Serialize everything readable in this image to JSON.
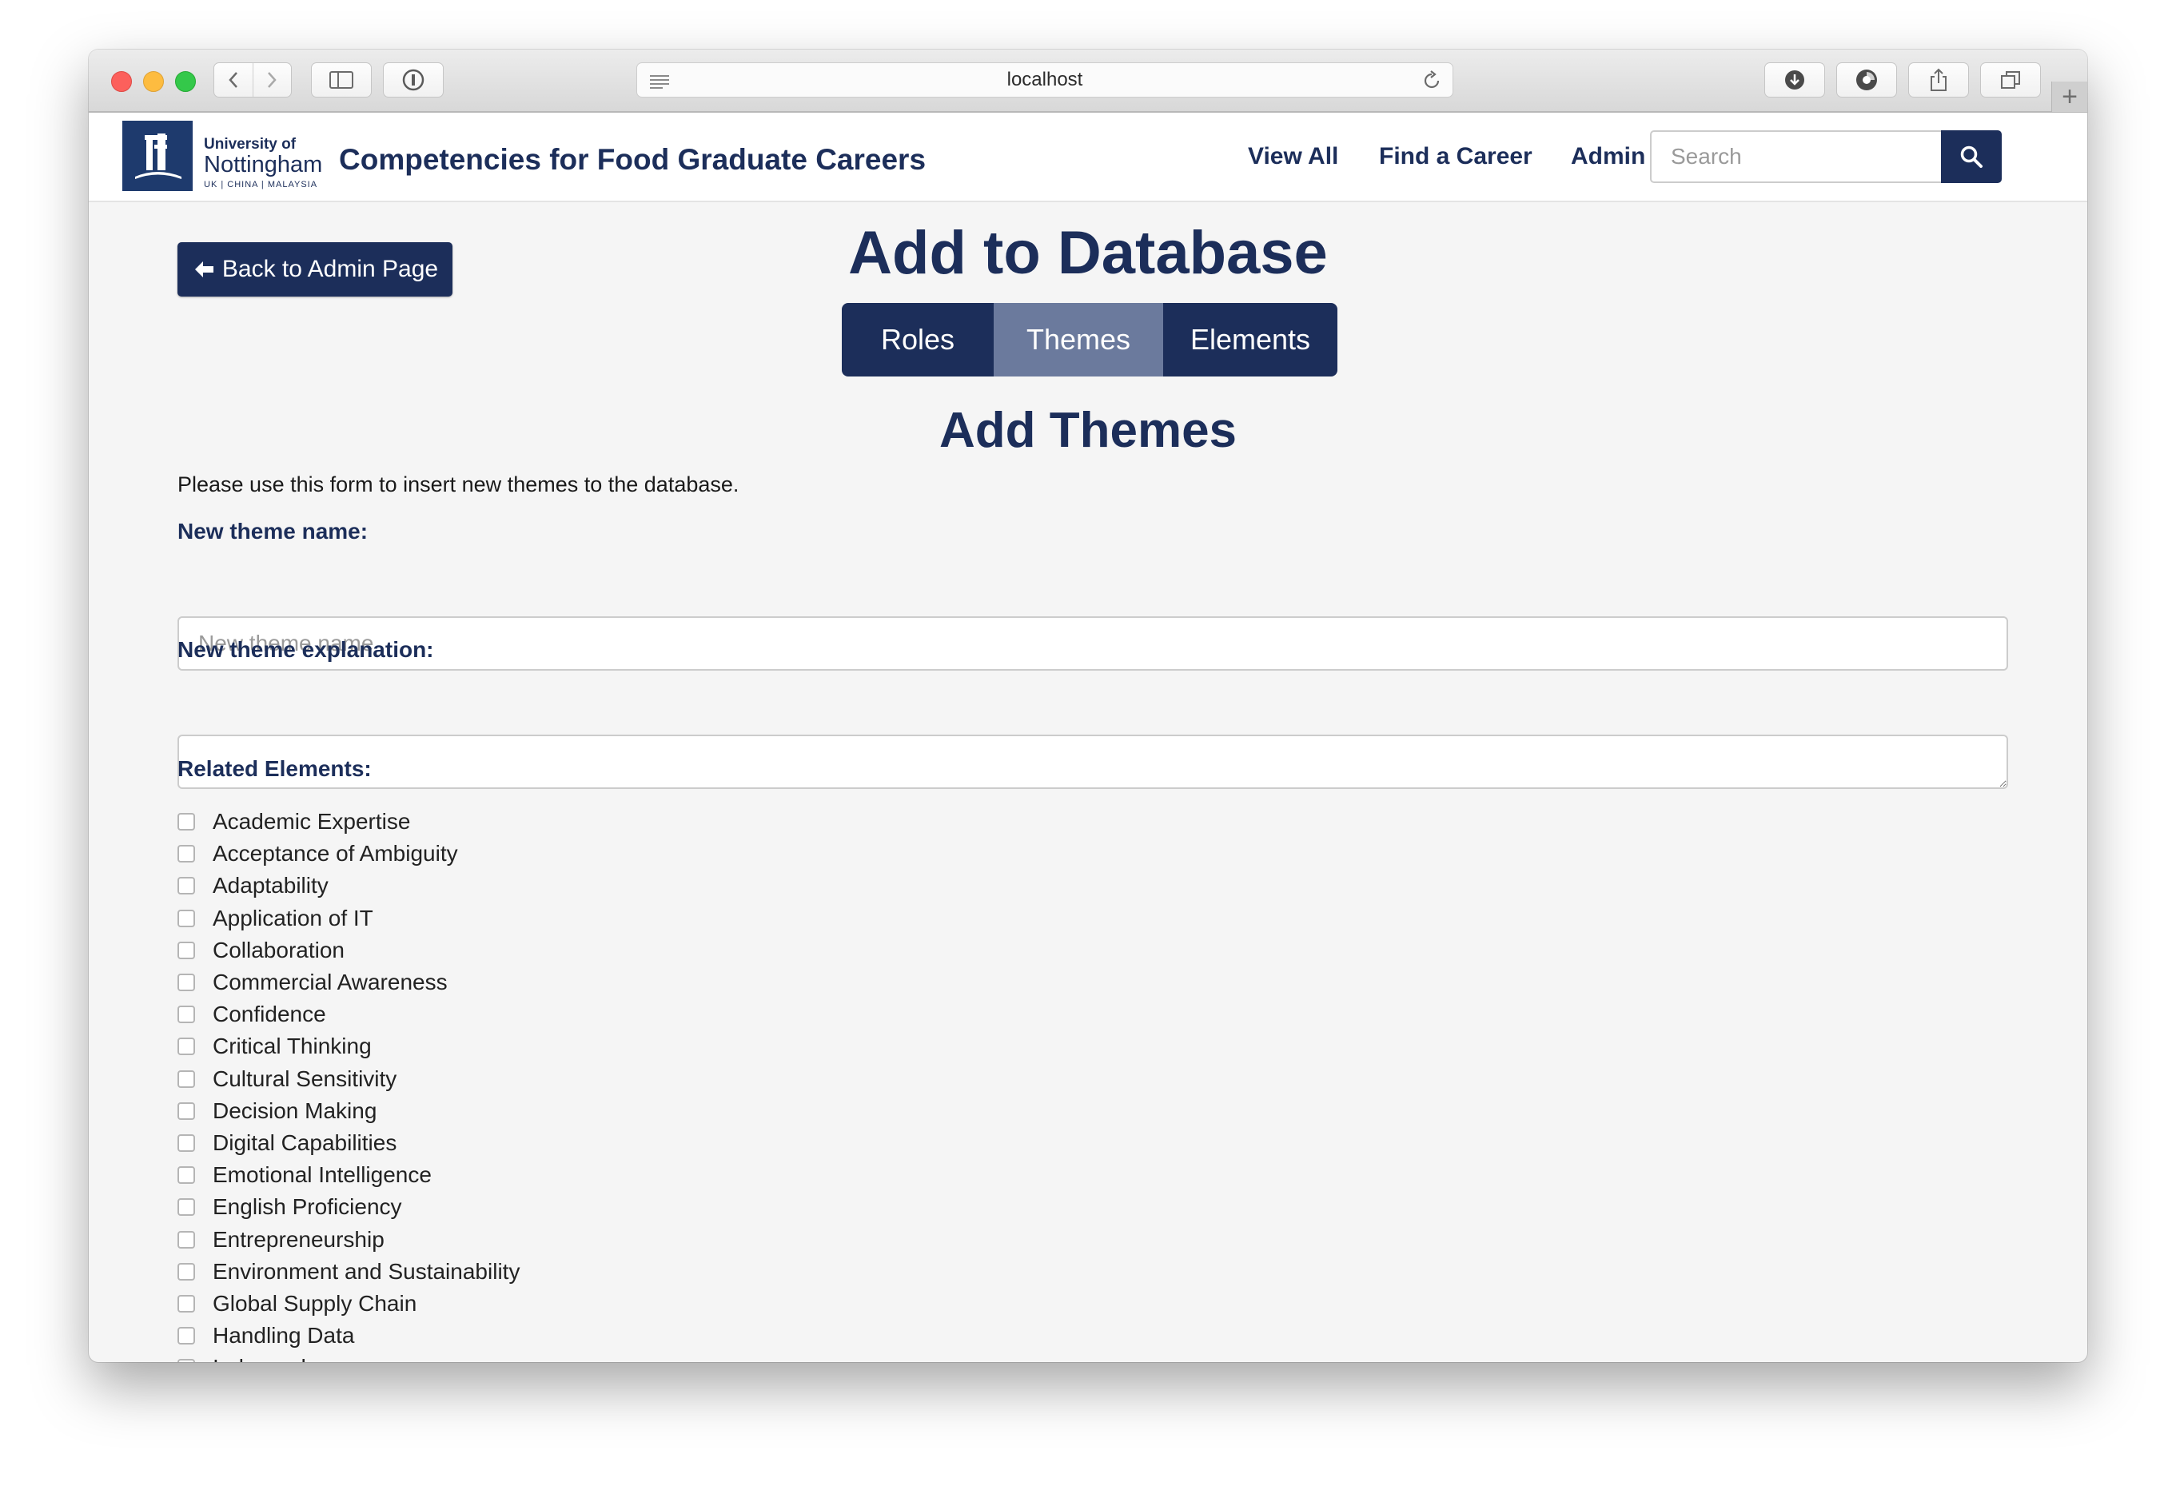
{
  "browser": {
    "url": "localhost"
  },
  "site": {
    "logo": {
      "line1": "University of",
      "line2": "Nottingham",
      "line3": "UK | CHINA | MALAYSIA"
    },
    "title": "Competencies for Food Graduate Careers",
    "nav": {
      "view_all": "View All",
      "find_career": "Find a Career",
      "admin": "Admin"
    },
    "search": {
      "placeholder": "Search"
    }
  },
  "page": {
    "back_button": "Back to Admin Page",
    "title": "Add to Database",
    "tabs": [
      {
        "label": "Roles",
        "active": false
      },
      {
        "label": "Themes",
        "active": true
      },
      {
        "label": "Elements",
        "active": false
      }
    ],
    "section_title": "Add Themes",
    "intro": "Please use this form to insert new themes to the database.",
    "form": {
      "name_label": "New theme name:",
      "name_placeholder": "New theme name",
      "name_value": "",
      "explanation_label": "New theme explanation:",
      "explanation_value": "",
      "related_label": "Related Elements:",
      "elements": [
        {
          "label": "Academic Expertise",
          "checked": false
        },
        {
          "label": "Acceptance of Ambiguity",
          "checked": false
        },
        {
          "label": "Adaptability",
          "checked": false
        },
        {
          "label": "Application of IT",
          "checked": false
        },
        {
          "label": "Collaboration",
          "checked": false
        },
        {
          "label": "Commercial Awareness",
          "checked": false
        },
        {
          "label": "Confidence",
          "checked": false
        },
        {
          "label": "Critical Thinking",
          "checked": false
        },
        {
          "label": "Cultural Sensitivity",
          "checked": false
        },
        {
          "label": "Decision Making",
          "checked": false
        },
        {
          "label": "Digital Capabilities",
          "checked": false
        },
        {
          "label": "Emotional Intelligence",
          "checked": false
        },
        {
          "label": "English Proficiency",
          "checked": false
        },
        {
          "label": "Entrepreneurship",
          "checked": false
        },
        {
          "label": "Environment and Sustainability",
          "checked": false
        },
        {
          "label": "Global Supply Chain",
          "checked": false
        },
        {
          "label": "Handling Data",
          "checked": false
        },
        {
          "label": "Independence",
          "checked": false
        }
      ]
    }
  },
  "colors": {
    "brand_navy": "#1c2e5a",
    "active_tab": "#6b7a9d",
    "page_bg": "#f5f5f5"
  }
}
